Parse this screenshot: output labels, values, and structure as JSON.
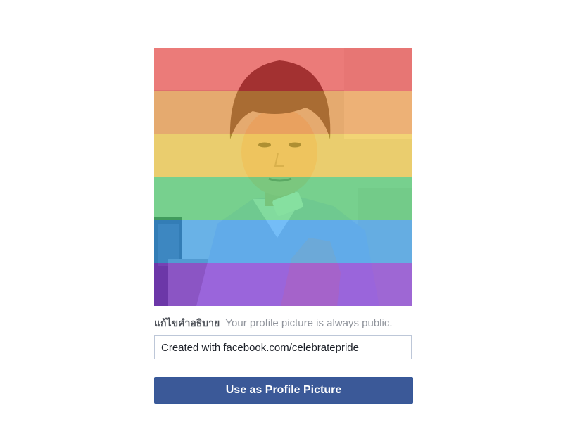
{
  "profile_photo": {
    "icon": "person-portrait",
    "overlay_colors": [
      "#ee3a3a",
      "#f79a3e",
      "#ffd23b",
      "#45d66f",
      "#2fa7ff",
      "#8a36e8"
    ]
  },
  "caption": {
    "edit_link": "แก้ไขคำอธิบาย",
    "privacy_note": "Your profile picture is always public.",
    "input_value": "Created with facebook.com/celebratepride"
  },
  "actions": {
    "use_as_profile_picture": "Use as Profile Picture"
  },
  "colors": {
    "button": "#3b5998",
    "muted_text": "#90949c"
  }
}
